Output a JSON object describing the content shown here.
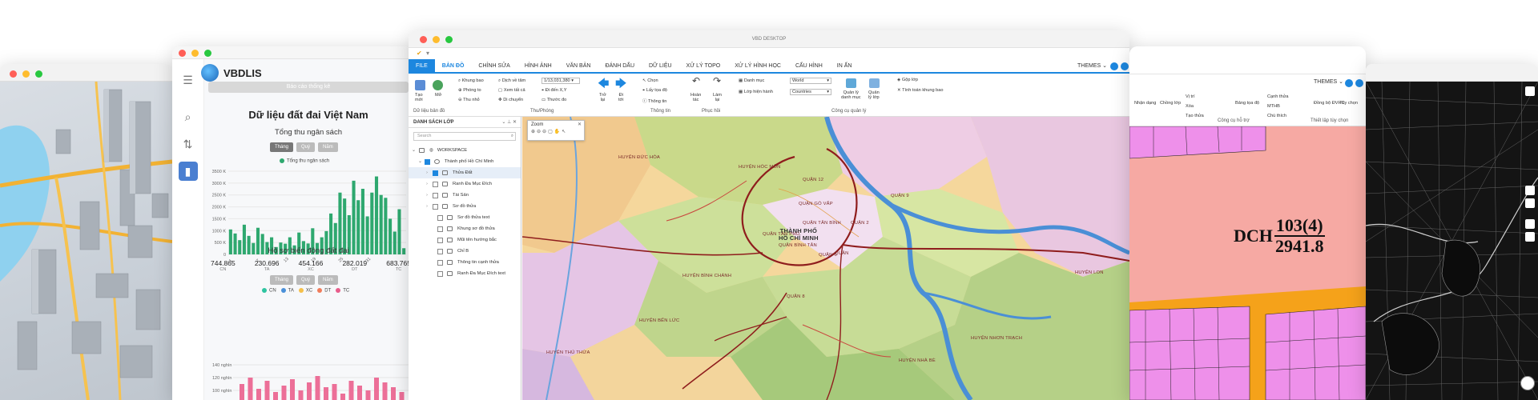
{
  "dashboard": {
    "brand": "VBDLIS",
    "report_button": "Báo cáo thống kê",
    "title": "Dữ liệu đất đai Việt Nam",
    "revenue": {
      "subtitle": "Tổng thu ngân sách",
      "tabs": [
        "Tháng",
        "Quý",
        "Năm"
      ],
      "legend": "Tổng thu ngân sách"
    },
    "changes": {
      "subtitle": "Hồ sơ biến động đất đai",
      "stats": [
        {
          "value": "744.865",
          "code": "CN"
        },
        {
          "value": "230.696",
          "code": "TA"
        },
        {
          "value": "454.166",
          "code": "XC"
        },
        {
          "value": "282.019",
          "code": "DT"
        },
        {
          "value": "683.765",
          "code": "TC"
        }
      ],
      "tabs": [
        "Tháng",
        "Quý",
        "Năm"
      ],
      "legend": [
        "CN",
        "TA",
        "XC",
        "DT",
        "TC"
      ],
      "y_ticks": [
        "140 nghìn",
        "120 nghìn",
        "100 nghìn"
      ]
    }
  },
  "chart_data": {
    "type": "bar",
    "title": "Tổng thu ngân sách",
    "ylim": [
      0,
      3500
    ],
    "y_ticks": [
      "3500 K",
      "3000 K",
      "2500 K",
      "2000 K",
      "1500 K",
      "1000 K",
      "500 K",
      "0"
    ],
    "x_ticks": [
      "1",
      "7",
      "13",
      "19",
      "25",
      "31"
    ],
    "values": [
      1050,
      880,
      600,
      1250,
      780,
      480,
      1120,
      860,
      520,
      720,
      310,
      500,
      450,
      720,
      380,
      920,
      560,
      460,
      1100,
      480,
      720,
      980,
      1720,
      1320,
      2600,
      2350,
      1650,
      3100,
      2280,
      2760,
      1600,
      2600,
      3280,
      2500,
      2380,
      1500,
      960,
      1900,
      260
    ],
    "color": "#2ea86f"
  },
  "desktop": {
    "window_title": "VBD DESKTOP",
    "menu": [
      "FILE",
      "BẢN ĐỒ",
      "CHỈNH SỬA",
      "HÌNH ẢNH",
      "VĂN BẢN",
      "ĐÁNH DẤU",
      "DỮ LIỆU",
      "XỬ LÝ TOPO",
      "XỬ LÝ HÌNH HỌC",
      "CẤU HÌNH",
      "IN ẤN"
    ],
    "themes": "THEMES",
    "ribbon": {
      "new_label": "Tạo\nmới",
      "open_label": "Mở",
      "khung_bao": "Khung bao",
      "phong_to": "Phóng to",
      "thu_nho": "Thu nhỏ",
      "dich_ve_tam": "Dịch về tâm",
      "xem_tat_ca": "Xem tất cả",
      "di_chuyen": "Di chuyển",
      "scale": "1/13,031,380",
      "di_den": "Đi đến X,Y",
      "thuoc_do": "Thước đo",
      "tro_lai": "Trở\nlại",
      "di_toi": "Đi\ntới",
      "chon": "Chọn",
      "lay_toa_do": "Lấy tọa độ",
      "thong_tin": "Thông tin",
      "hoan_tac": "Hoàn\ntác",
      "lam_lai": "Làm\nlại",
      "danh_muc": "Danh mục",
      "danh_muc_val": "World",
      "lop_hien_hanh": "Lớp hiện hành",
      "lop_hien_hanh_val": "Countries",
      "quan_ly_danh_muc": "Quản lý\ndanh mục",
      "quan_ly_lop": "Quản\nlý lớp",
      "gop_lop": "Gộp lớp",
      "tinh_toan": "Tính toán khung bao",
      "groups": [
        "Dữ liệu bản đồ",
        "Thu/Phóng",
        "Thông tin",
        "Phục hồi",
        "Công cụ quản lý"
      ]
    },
    "panel": {
      "title": "DANH SÁCH LỚP",
      "search_placeholder": "Search",
      "workspace": "WORKSPACE",
      "city": "Thành phố Hồ Chí Minh",
      "layers": [
        "Thửa Đất",
        "Ranh Đa Mục Đích",
        "Tài Sản",
        "Sơ đồ thửa",
        "Sơ đồ thửa text",
        "Khung sơ đồ thửa",
        "Mũi tên hướng bắc",
        "Chỉ B",
        "Thông tin cạnh thửa",
        "Ranh Đa Mục Đích text"
      ]
    },
    "zoom_title": "Zoom",
    "map_labels": {
      "center": "THÀNH PHỐ\nHỒ CHÍ MINH",
      "districts": [
        "HUYỆN ĐỨC HÒA",
        "HUYỆN HÓC MÔN",
        "QUẬN 12",
        "QUẬN GÒ VẤP",
        "QUẬN TÂN BÌNH",
        "QUẬN TÂN PHÚ",
        "QUẬN BÌNH TÂN",
        "QUẬN",
        "QUẬN 6",
        "QUẬN 8",
        "HUYỆN BÌNH CHÁNH",
        "HUYỆN BẾN LỨC",
        "HUYỆN THỦ THỪA",
        "HUYỆN NHÀ BÈ",
        "HUYỆN NHƠN TRẠCH",
        "HUYỆN LON",
        "QUẬN 2",
        "QUẬN 9"
      ]
    }
  },
  "parcel": {
    "themes": "THEMES",
    "tools": [
      "Nhận dạng",
      "Chồng lớp",
      "Vị trí",
      "Xóa",
      "Tạo thửa",
      "Bảng tọa độ",
      "Cạnh thửa",
      "MTHB",
      "Chú thích",
      "Đồng bộ ĐVHC",
      "Tùy chọn"
    ],
    "groups": [
      "Công cụ hỗ trợ",
      "Thiết lập tùy chọn"
    ],
    "label_prefix": "DCH",
    "label_num": "103(4)",
    "label_den": "2941.8"
  }
}
